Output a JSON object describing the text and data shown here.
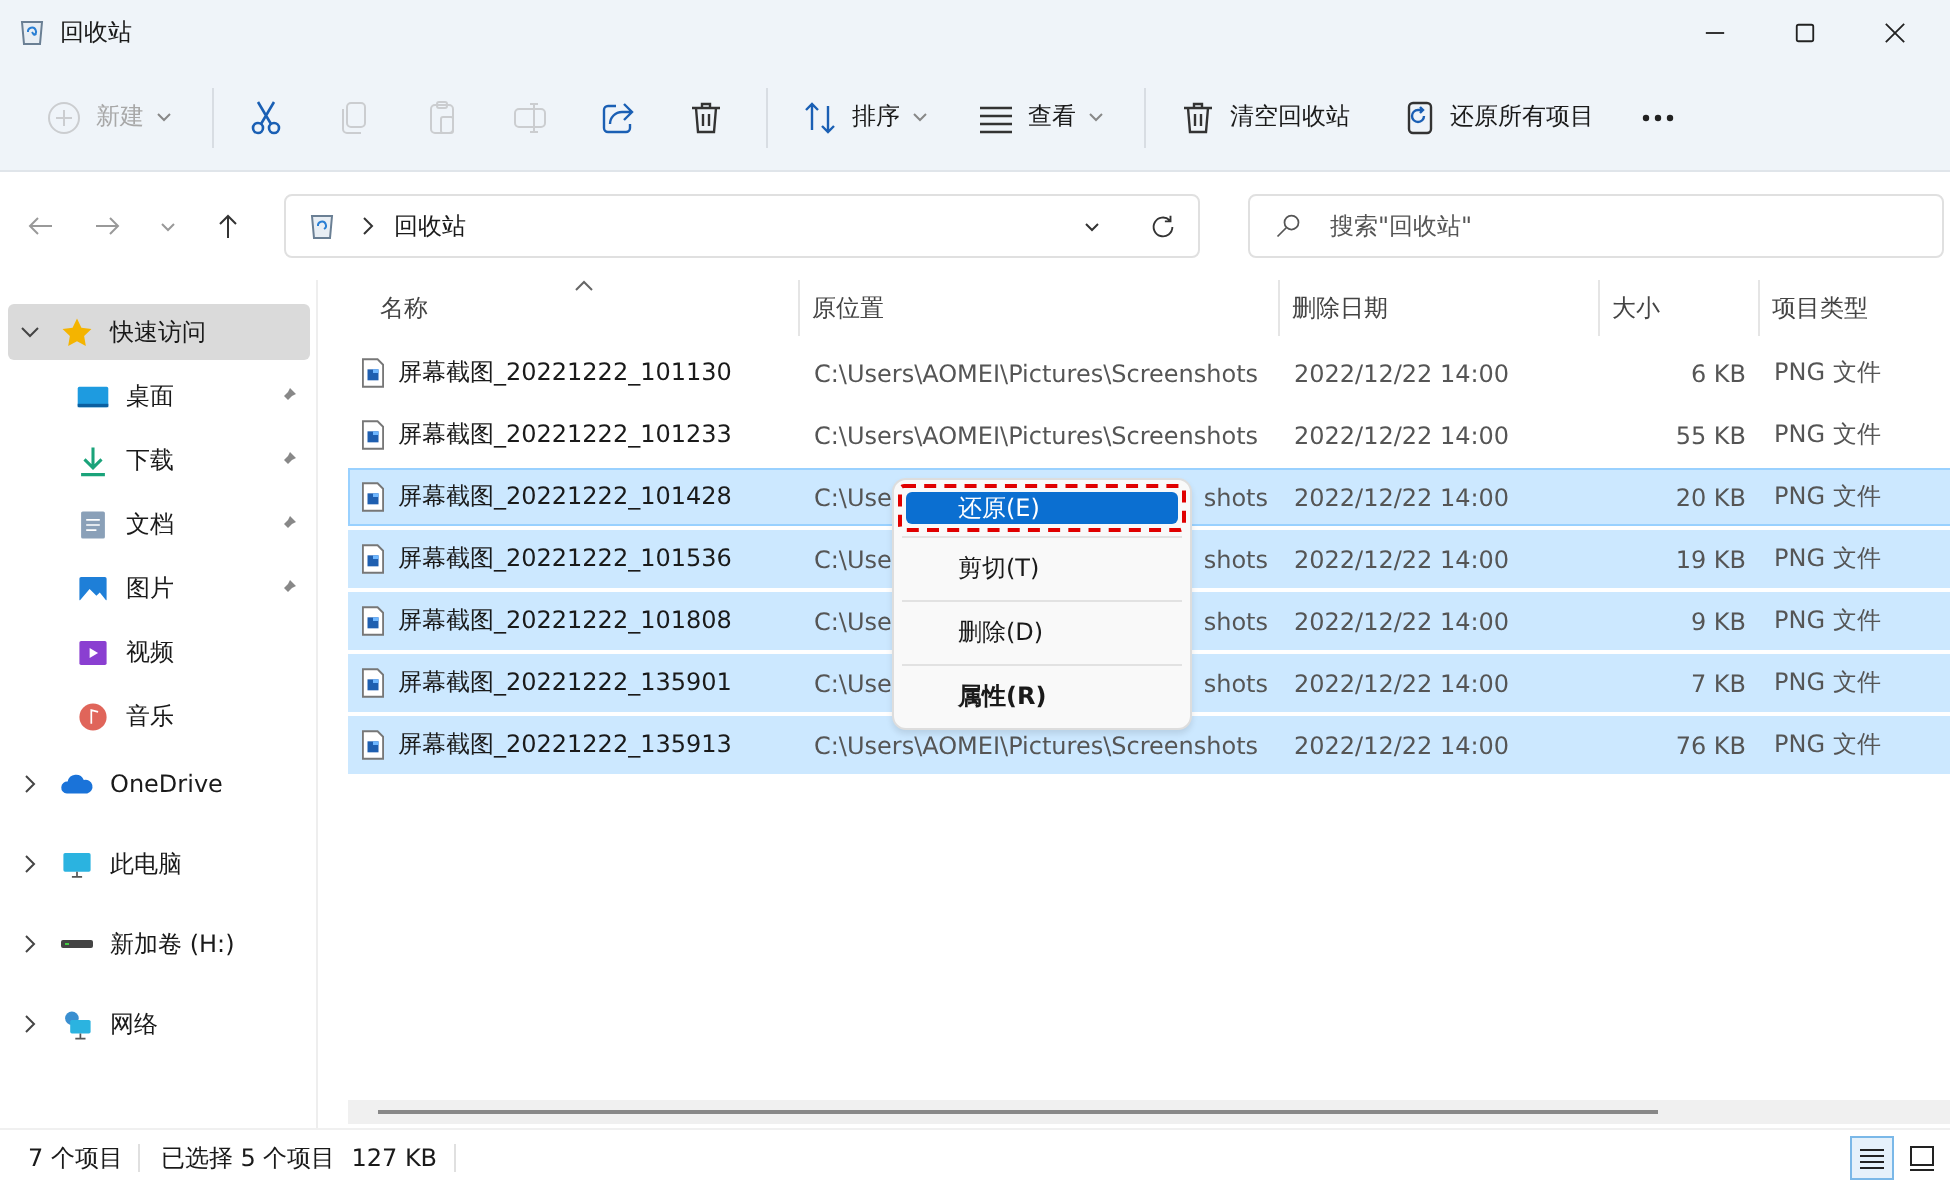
{
  "window": {
    "title": "回收站"
  },
  "toolbar": [
    {
      "kind": "new",
      "label": "新建",
      "disabled": true
    },
    {
      "kind": "separator"
    },
    {
      "kind": "cut",
      "disabled": false
    },
    {
      "kind": "copy",
      "disabled": true
    },
    {
      "kind": "paste",
      "disabled": true
    },
    {
      "kind": "rename",
      "disabled": true
    },
    {
      "kind": "share",
      "disabled": false
    },
    {
      "kind": "delete",
      "disabled": false
    },
    {
      "kind": "separator"
    },
    {
      "kind": "sort",
      "label": "排序",
      "disabled": false
    },
    {
      "kind": "view",
      "label": "查看",
      "disabled": false
    },
    {
      "kind": "separator"
    },
    {
      "kind": "empty",
      "label": "清空回收站",
      "disabled": false
    },
    {
      "kind": "restore_all",
      "label": "还原所有项目",
      "disabled": false
    },
    {
      "kind": "more",
      "disabled": false
    }
  ],
  "address": {
    "crumbs": [
      "回收站"
    ]
  },
  "search": {
    "placeholder": "搜索\"回收站\""
  },
  "sidebar": [
    {
      "kind": "quick_access",
      "label": "快速访问",
      "expanded": true,
      "selected": true,
      "children": [
        {
          "kind": "desktop",
          "label": "桌面",
          "pinned": true
        },
        {
          "kind": "downloads",
          "label": "下载",
          "pinned": true
        },
        {
          "kind": "documents",
          "label": "文档",
          "pinned": true
        },
        {
          "kind": "pictures",
          "label": "图片",
          "pinned": true
        },
        {
          "kind": "videos",
          "label": "视频",
          "pinned": false
        },
        {
          "kind": "music",
          "label": "音乐",
          "pinned": false
        }
      ]
    },
    {
      "kind": "onedrive",
      "label": "OneDrive",
      "expanded": false,
      "selected": false
    },
    {
      "kind": "pc",
      "label": "此电脑",
      "expanded": false,
      "selected": false
    },
    {
      "kind": "drive",
      "label": "新加卷 (H:)",
      "expanded": false,
      "selected": false
    },
    {
      "kind": "network",
      "label": "网络",
      "expanded": false,
      "selected": false
    }
  ],
  "table": {
    "columns": [
      {
        "label": "名称",
        "sorted": true
      },
      {
        "label": "原位置",
        "sorted": false
      },
      {
        "label": "删除日期",
        "sorted": false
      },
      {
        "label": "大小",
        "sorted": false
      },
      {
        "label": "项目类型",
        "sorted": false
      }
    ],
    "rows": [
      {
        "name": "屏幕截图_20221222_101130",
        "path": "C:\\Users\\AOMEI\\Pictures\\Screenshots",
        "date": "2022/12/22 14:00",
        "size": "6 KB",
        "type": "PNG 文件",
        "selected": false,
        "focused": false
      },
      {
        "name": "屏幕截图_20221222_101233",
        "path": "C:\\Users\\AOMEI\\Pictures\\Screenshots",
        "date": "2022/12/22 14:00",
        "size": "55 KB",
        "type": "PNG 文件",
        "selected": false,
        "focused": false
      },
      {
        "name": "屏幕截图_20221222_101428",
        "path": "C:\\Use",
        "path_tail": "shots",
        "date": "2022/12/22 14:00",
        "size": "20 KB",
        "type": "PNG 文件",
        "selected": true,
        "focused": true
      },
      {
        "name": "屏幕截图_20221222_101536",
        "path": "C:\\Use",
        "path_tail": "shots",
        "date": "2022/12/22 14:00",
        "size": "19 KB",
        "type": "PNG 文件",
        "selected": true,
        "focused": false
      },
      {
        "name": "屏幕截图_20221222_101808",
        "path": "C:\\Use",
        "path_tail": "shots",
        "date": "2022/12/22 14:00",
        "size": "9 KB",
        "type": "PNG 文件",
        "selected": true,
        "focused": false
      },
      {
        "name": "屏幕截图_20221222_135901",
        "path": "C:\\Use",
        "path_tail": "shots",
        "date": "2022/12/22 14:00",
        "size": "7 KB",
        "type": "PNG 文件",
        "selected": true,
        "focused": false
      },
      {
        "name": "屏幕截图_20221222_135913",
        "path": "C:\\Users\\AOMEI\\Pictures\\Screenshots",
        "date": "2022/12/22 14:00",
        "size": "76 KB",
        "type": "PNG 文件",
        "selected": true,
        "focused": false
      }
    ]
  },
  "context_menu": {
    "items": [
      {
        "label": "还原(E)",
        "selected": true,
        "marked": true,
        "bold": false
      },
      {
        "label": "剪切(T)",
        "selected": false,
        "marked": false,
        "bold": false
      },
      {
        "label": "删除(D)",
        "selected": false,
        "marked": false,
        "bold": false
      },
      {
        "label": "属性(R)",
        "selected": false,
        "marked": false,
        "bold": true
      }
    ]
  },
  "status_bar": {
    "texts": [
      "7 个项目",
      "已选择 5 个项目",
      "127 KB"
    ],
    "views": [
      {
        "kind": "details",
        "selected": true
      },
      {
        "kind": "tiles",
        "selected": false
      }
    ]
  }
}
